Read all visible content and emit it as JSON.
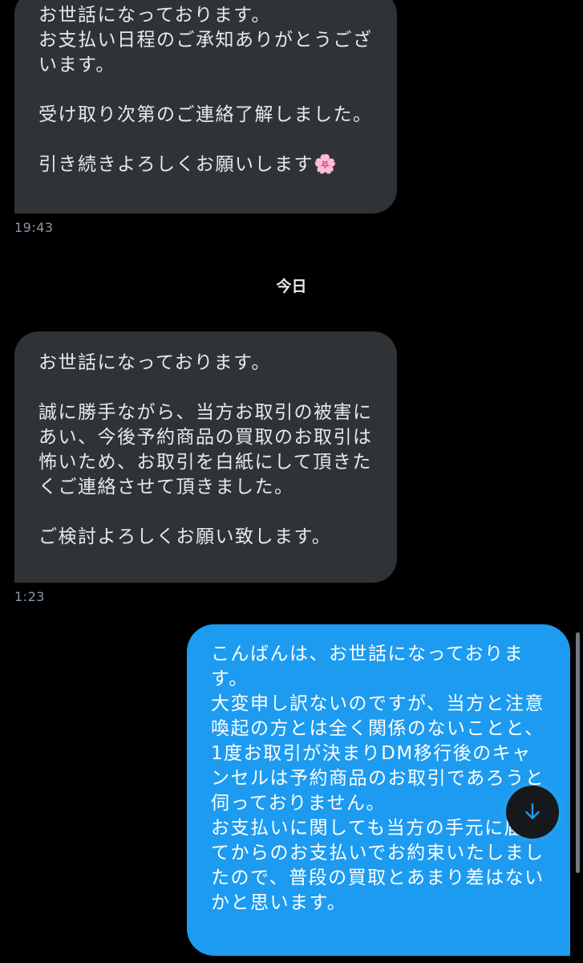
{
  "conversation": {
    "messages": [
      {
        "direction": "incoming",
        "text": "お世話になっております。\nお支払い日程のご承知ありがとうござ\nいます。\n\n受け取り次第のご連絡了解しました。\n\n引き続きよろしくお願いします🌸",
        "time": "19:43"
      },
      {
        "direction": "incoming",
        "text": "お世話になっております。\n\n誠に勝手ながら、当方お取引の被害に\nあい、今後予約商品の買取のお取引は\n怖いため、お取引を白紙にして頂きた\nくご連絡させて頂きました。\n\nご検討よろしくお願い致します。",
        "time": "1:23"
      },
      {
        "direction": "outgoing",
        "text": "こんばんは、お世話になっておりま\nす。\n大変申し訳ないのですが、当方と注意\n喚起の方とは全く関係のないことと、\n1度お取引が決まりDM移行後のキャ\nンセルは予約商品のお取引であろうと\n伺っておりません。\nお支払いに関しても当方の手元に届い\nてからのお支払いでお約束いたしまし\nたので、普段の買取とあまり差はない\nかと思います。"
      }
    ],
    "date_divider": "今日"
  },
  "colors": {
    "background": "#000000",
    "incoming_bubble": "#2f3336",
    "outgoing_bubble": "#1d9bf0",
    "timestamp": "#8b98a5"
  },
  "controls": {
    "scroll_down_icon": "arrow-down-icon"
  }
}
